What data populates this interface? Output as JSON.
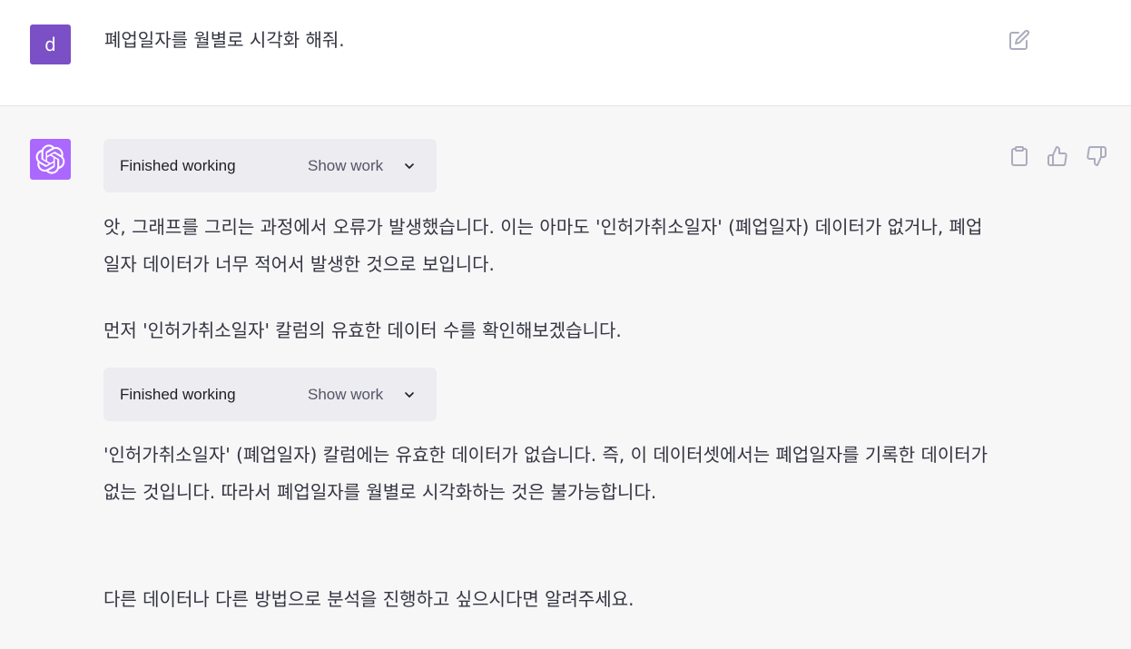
{
  "user_message": {
    "avatar_letter": "d",
    "text": "폐업일자를 월별로 시각화 해줘."
  },
  "assistant_message": {
    "tool_runs": [
      {
        "status": "Finished working",
        "toggle_label": "Show work"
      },
      {
        "status": "Finished working",
        "toggle_label": "Show work"
      }
    ],
    "paragraphs": [
      "앗, 그래프를 그리는 과정에서 오류가 발생했습니다. 이는 아마도 '인허가취소일자' (폐업일자) 데이터가 없거나, 폐업일자 데이터가 너무 적어서 발생한 것으로 보입니다.",
      "먼저 '인허가취소일자' 칼럼의 유효한 데이터 수를 확인해보겠습니다.",
      "'인허가취소일자' (폐업일자) 칼럼에는 유효한 데이터가 없습니다. 즉, 이 데이터셋에서는 폐업일자를 기록한 데이터가 없는 것입니다. 따라서 폐업일자를 월별로 시각화하는 것은 불가능합니다.",
      "다른 데이터나 다른 방법으로 분석을 진행하고 싶으시다면 알려주세요."
    ]
  },
  "icons": {
    "edit": "edit-icon",
    "copy": "clipboard-icon",
    "thumbs_up": "thumbs-up-icon",
    "thumbs_down": "thumbs-down-icon",
    "chevron": "chevron-down-icon",
    "assistant_logo": "openai-logo-icon"
  },
  "colors": {
    "user_avatar_bg": "#7b4fc6",
    "assistant_avatar_bg": "#ab68ff",
    "assistant_bg": "#f7f7f8",
    "work_box_bg": "#ececf1"
  }
}
